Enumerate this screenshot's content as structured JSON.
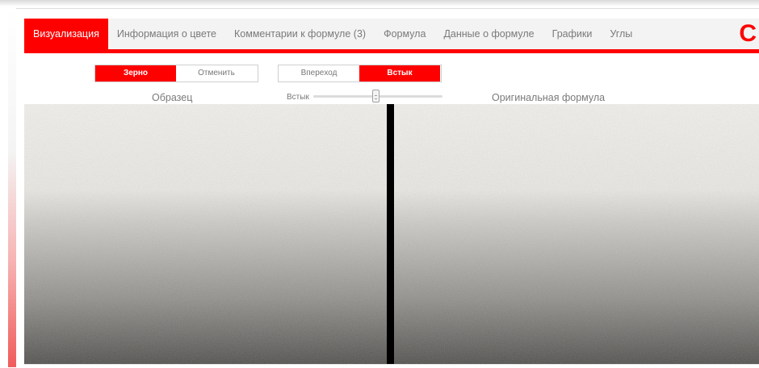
{
  "tabs": [
    {
      "label": "Визуализация",
      "active": true
    },
    {
      "label": "Информация о цвете",
      "active": false
    },
    {
      "label": "Комментарии к формуле (3)",
      "active": false
    },
    {
      "label": "Формула",
      "active": false
    },
    {
      "label": "Данные о формуле",
      "active": false
    },
    {
      "label": "Графики",
      "active": false
    },
    {
      "label": "Углы",
      "active": false
    }
  ],
  "logo_letter": "C",
  "mode_toggle": {
    "grain": "Зерно",
    "cancel": "Отменить",
    "selected": "grain"
  },
  "view_toggle": {
    "forward": "Вперeход",
    "butt": "Встык",
    "selected": "butt"
  },
  "labels": {
    "sample": "Образец",
    "original": "Оригинальная формула"
  },
  "slider": {
    "label": "Встык",
    "value": 0.5
  },
  "colors": {
    "accent": "#ff0000",
    "swatch_top": "#f5f3ef",
    "swatch_bottom": "#4a4946"
  }
}
